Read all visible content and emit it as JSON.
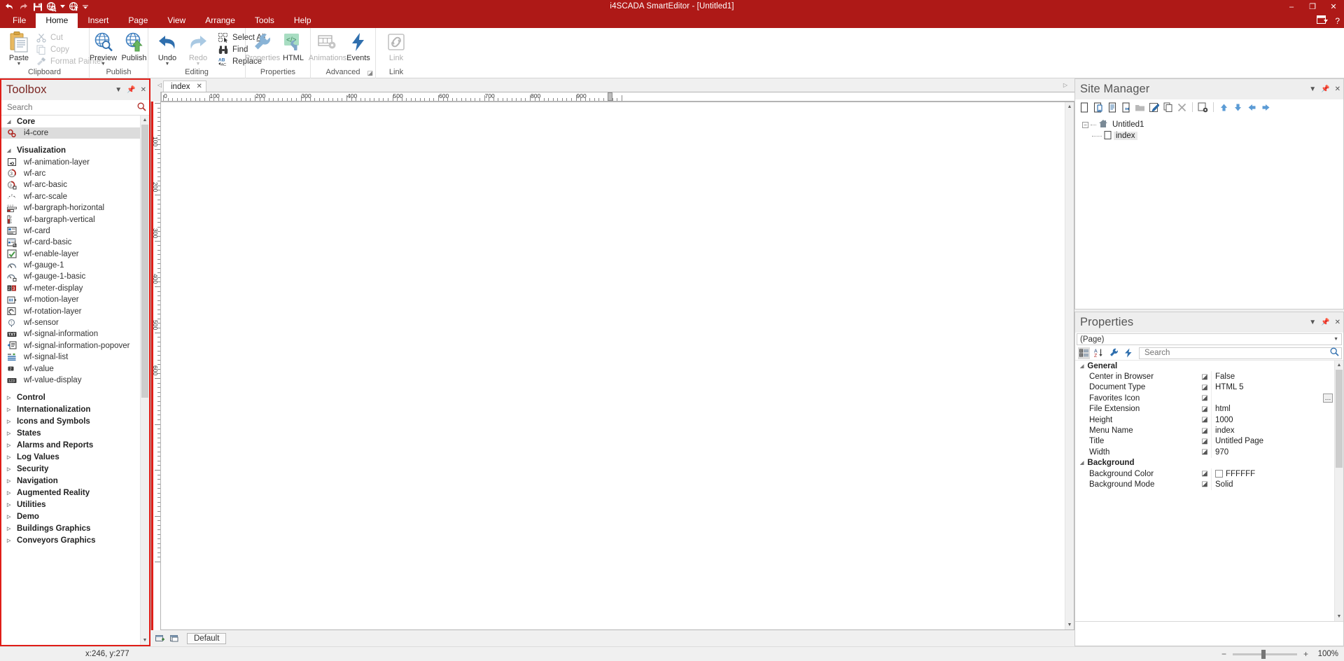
{
  "window": {
    "title": "i4SCADA SmartEditor - [Untitled1]",
    "minimize": "–",
    "restore": "❐",
    "close": "✕",
    "help": "?"
  },
  "quick_access": [
    "undo-icon",
    "redo-icon",
    "save-icon",
    "preview-icon",
    "dropdown-caret-icon",
    "publish-icon",
    "more-caret-icon"
  ],
  "ribbon": {
    "tabs": [
      {
        "label": "File",
        "active": false
      },
      {
        "label": "Home",
        "active": true
      },
      {
        "label": "Insert",
        "active": false
      },
      {
        "label": "Page",
        "active": false
      },
      {
        "label": "View",
        "active": false
      },
      {
        "label": "Arrange",
        "active": false
      },
      {
        "label": "Tools",
        "active": false
      },
      {
        "label": "Help",
        "active": false
      }
    ],
    "groups": {
      "clipboard": {
        "label": "Clipboard",
        "paste": "Paste",
        "cut": "Cut",
        "copy": "Copy",
        "format_painter": "Format Painter"
      },
      "publish": {
        "label": "Publish",
        "preview": "Preview",
        "publish": "Publish"
      },
      "editing": {
        "label": "Editing",
        "undo": "Undo",
        "redo": "Redo",
        "select_all_pre": "Select ",
        "select_all_key": "A",
        "select_all_post": "ll",
        "find": "Find",
        "replace": "Replace"
      },
      "properties": {
        "label": "Properties",
        "properties": "Properties",
        "html": "HTML"
      },
      "advanced": {
        "label": "Advanced",
        "animations": "Animations",
        "events": "Events"
      },
      "link": {
        "label": "Link",
        "link": "Link"
      }
    }
  },
  "toolbox": {
    "title": "Toolbox",
    "search_placeholder": "Search",
    "search_value": "",
    "groups": [
      {
        "name": "Core",
        "expanded": true,
        "items": [
          {
            "label": "i4-core",
            "icon": "gears-icon",
            "selected": true
          }
        ]
      },
      {
        "name": "Visualization",
        "expanded": true,
        "items": [
          {
            "label": "wf-animation-layer",
            "icon": "animation-layer-icon",
            "selected": false
          },
          {
            "label": "wf-arc",
            "icon": "arc-icon",
            "selected": false
          },
          {
            "label": "wf-arc-basic",
            "icon": "arc-basic-icon",
            "selected": false
          },
          {
            "label": "wf-arc-scale",
            "icon": "arc-scale-icon",
            "selected": false
          },
          {
            "label": "wf-bargraph-horizontal",
            "icon": "bargraph-horizontal-icon",
            "selected": false
          },
          {
            "label": "wf-bargraph-vertical",
            "icon": "bargraph-vertical-icon",
            "selected": false
          },
          {
            "label": "wf-card",
            "icon": "card-icon",
            "selected": false
          },
          {
            "label": "wf-card-basic",
            "icon": "card-basic-icon",
            "selected": false
          },
          {
            "label": "wf-enable-layer",
            "icon": "enable-layer-icon",
            "selected": false
          },
          {
            "label": "wf-gauge-1",
            "icon": "gauge-icon",
            "selected": false
          },
          {
            "label": "wf-gauge-1-basic",
            "icon": "gauge-basic-icon",
            "selected": false
          },
          {
            "label": "wf-meter-display",
            "icon": "meter-display-icon",
            "selected": false
          },
          {
            "label": "wf-motion-layer",
            "icon": "motion-layer-icon",
            "selected": false
          },
          {
            "label": "wf-rotation-layer",
            "icon": "rotation-layer-icon",
            "selected": false
          },
          {
            "label": "wf-sensor",
            "icon": "sensor-icon",
            "selected": false
          },
          {
            "label": "wf-signal-information",
            "icon": "signal-information-icon",
            "selected": false
          },
          {
            "label": "wf-signal-information-popover",
            "icon": "signal-information-popover-icon",
            "selected": false
          },
          {
            "label": "wf-signal-list",
            "icon": "signal-list-icon",
            "selected": false
          },
          {
            "label": "wf-value",
            "icon": "value-icon",
            "selected": false
          },
          {
            "label": "wf-value-display",
            "icon": "value-display-icon",
            "selected": false
          }
        ]
      }
    ],
    "collapsed_groups": [
      "Control",
      "Internationalization",
      "Icons and Symbols",
      "States",
      "Alarms and Reports",
      "Log Values",
      "Security",
      "Navigation",
      "Augmented Reality",
      "Utilities",
      "Demo",
      "Buildings Graphics",
      "Conveyors Graphics"
    ]
  },
  "editor": {
    "document_tab": "index",
    "document_tab_close": "✕",
    "hruler_labels": [
      "0",
      "100",
      "200",
      "300",
      "400",
      "500",
      "600",
      "700",
      "800",
      "900"
    ],
    "vruler_labels": [
      "100",
      "200",
      "300",
      "400",
      "500",
      "600"
    ],
    "layer_name": "Default"
  },
  "site_manager": {
    "title": "Site Manager",
    "toolbar": [
      "new-page-icon",
      "new-mobile-page-icon",
      "new-template-icon",
      "new-link-icon",
      "new-folder-icon",
      "edit-icon",
      "copy-icon",
      "delete-icon",
      "settings-icon",
      "move-up-icon",
      "move-down-icon",
      "move-left-icon",
      "move-right-icon"
    ],
    "tree": {
      "root": "Untitled1",
      "children": [
        "index"
      ]
    }
  },
  "properties": {
    "title": "Properties",
    "target": "(Page)",
    "toolbar": [
      "categorized-icon",
      "alphabetical-icon",
      "properties-icon",
      "events-icon"
    ],
    "search_placeholder": "Search",
    "search_value": "",
    "categories": [
      {
        "name": "General",
        "rows": [
          {
            "name": "Center in Browser",
            "value": "False",
            "swatch": null,
            "ellipsis": false
          },
          {
            "name": "Document Type",
            "value": "HTML 5",
            "swatch": null,
            "ellipsis": false
          },
          {
            "name": "Favorites Icon",
            "value": "",
            "swatch": null,
            "ellipsis": true
          },
          {
            "name": "File Extension",
            "value": "html",
            "swatch": null,
            "ellipsis": false
          },
          {
            "name": "Height",
            "value": "1000",
            "swatch": null,
            "ellipsis": false
          },
          {
            "name": "Menu Name",
            "value": "index",
            "swatch": null,
            "ellipsis": false
          },
          {
            "name": "Title",
            "value": "Untitled Page",
            "swatch": null,
            "ellipsis": false
          },
          {
            "name": "Width",
            "value": "970",
            "swatch": null,
            "ellipsis": false
          }
        ]
      },
      {
        "name": "Background",
        "rows": [
          {
            "name": "Background Color",
            "value": "FFFFFF",
            "swatch": "#FFFFFF",
            "ellipsis": false
          },
          {
            "name": "Background Mode",
            "value": "Solid",
            "swatch": null,
            "ellipsis": false
          }
        ]
      }
    ]
  },
  "statusbar": {
    "coordinates": "x:246, y:277",
    "zoom_minus": "−",
    "zoom_plus": "+",
    "zoom_level": "100%"
  },
  "colors": {
    "accent_red": "#ae1917",
    "highlight_red": "#e01e18",
    "panel_title": "#7b2622"
  }
}
